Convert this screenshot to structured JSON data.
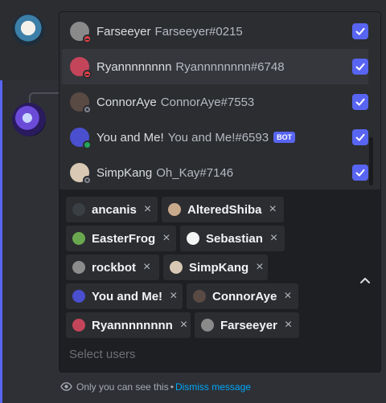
{
  "options": [
    {
      "name": "Farseeyer",
      "tag": "Farseeyer#0215",
      "status": "dnd",
      "avatar_color": "#8a8a8a",
      "checked": true,
      "bot": false
    },
    {
      "name": "Ryannnnnnnn",
      "tag": "Ryannnnnnnn#6748",
      "status": "dnd",
      "avatar_color": "#c4455a",
      "checked": true,
      "bot": false
    },
    {
      "name": "ConnorAye",
      "tag": "ConnorAye#7553",
      "status": "idle",
      "avatar_color": "#5a4a44",
      "checked": true,
      "bot": false
    },
    {
      "name": "You and Me!",
      "tag": "You and Me!#6593",
      "status": "online",
      "avatar_color": "#4a4fcf",
      "checked": true,
      "bot": true,
      "badge": "BOT"
    },
    {
      "name": "SimpKang",
      "tag": "Oh_Kay#7146",
      "status": "idle",
      "avatar_color": "#d9c8b4",
      "checked": true,
      "bot": false
    }
  ],
  "chips": [
    {
      "label": "ancanis",
      "avatar_color": "#3a3f44"
    },
    {
      "label": "AlteredShiba",
      "avatar_color": "#c9a98b"
    },
    {
      "label": "EasterFrog",
      "avatar_color": "#6aa84f"
    },
    {
      "label": "Sebastian",
      "avatar_color": "#f4f4f4"
    },
    {
      "label": "rockbot",
      "avatar_color": "#8c8c8c"
    },
    {
      "label": "SimpKang",
      "avatar_color": "#d9c8b4"
    },
    {
      "label": "You and Me!",
      "avatar_color": "#4a4fcf"
    },
    {
      "label": "ConnorAye",
      "avatar_color": "#5a4a44"
    },
    {
      "label": "Ryannnnnnnn",
      "avatar_color": "#c4455a"
    },
    {
      "label": "Farseeyer",
      "avatar_color": "#8a8a8a"
    }
  ],
  "remove_glyph": "×",
  "select": {
    "placeholder": "Select users"
  },
  "ephemeral": {
    "notice": "Only you can see this",
    "separator": "•",
    "dismiss": "Dismiss message"
  },
  "icons": {
    "check": "check-icon",
    "remove": "close-icon",
    "collapse": "chevron-up-icon",
    "visibility": "eye-icon"
  },
  "colors": {
    "accent": "#5865f2",
    "link": "#00a8fc",
    "dnd": "#f23f43",
    "idle": "#80848e",
    "online": "#23a55a"
  }
}
